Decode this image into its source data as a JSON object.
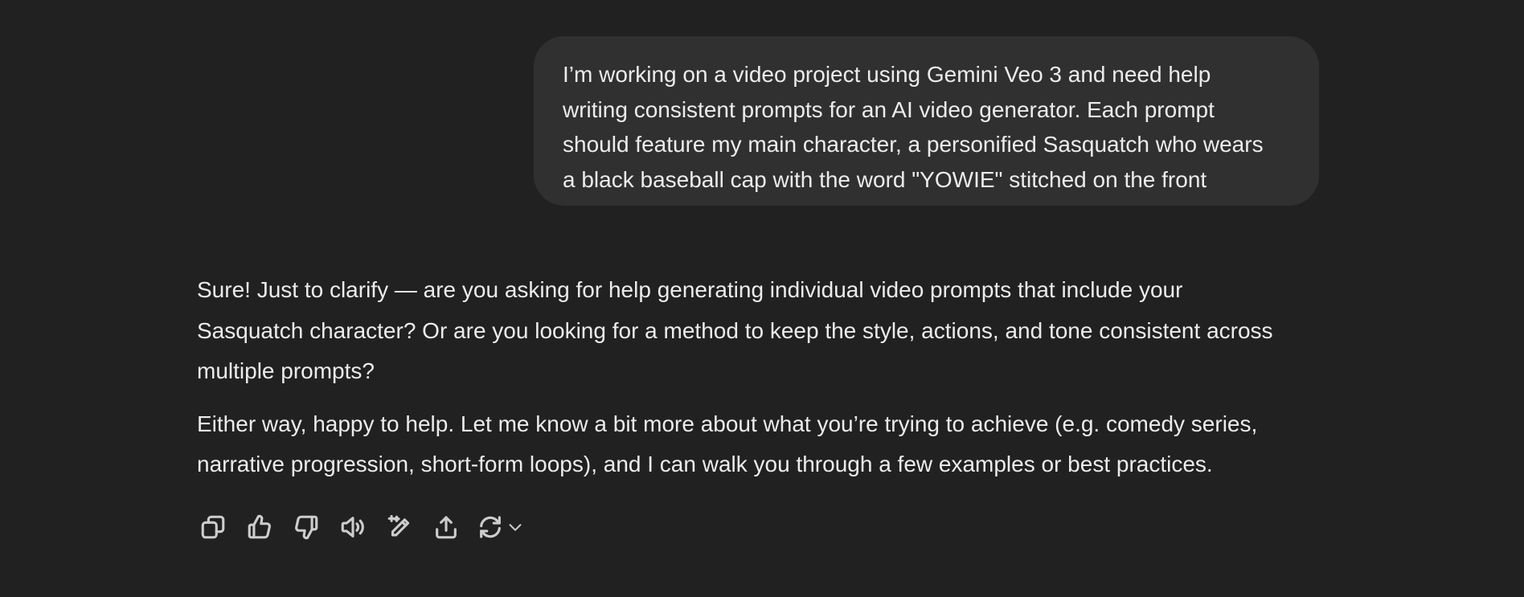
{
  "user_message": {
    "lines": [
      "I’m working on a video project using Gemini Veo 3 and need help",
      "writing consistent prompts for an AI video generator. Each prompt",
      "should feature my main character, a personified Sasquatch who wears",
      "a black baseball cap with the word \"YOWIE\" stitched on the front"
    ]
  },
  "assistant_message": {
    "paragraphs": [
      {
        "lines": [
          "Sure! Just to clarify — are you asking for help generating individual video prompts that include your",
          "Sasquatch character? Or are you looking for a method to keep the style, actions, and tone consistent across",
          "multiple prompts?"
        ]
      },
      {
        "lines": [
          "Either way, happy to help. Let me know a bit more about what you’re trying to achieve (e.g. comedy series,",
          "narrative progression, short-form loops), and I can walk you through a few examples or best practices."
        ]
      }
    ]
  },
  "action_bar": {
    "icons": [
      "copy-icon",
      "thumbs-up-icon",
      "thumbs-down-icon",
      "read-aloud-icon",
      "edit-icon",
      "share-icon",
      "regenerate-icon",
      "chevron-down-icon"
    ]
  },
  "colors": {
    "background": "#212121",
    "user_bubble": "#303030",
    "text": "#ececec",
    "icon": "#cdcdcd"
  }
}
